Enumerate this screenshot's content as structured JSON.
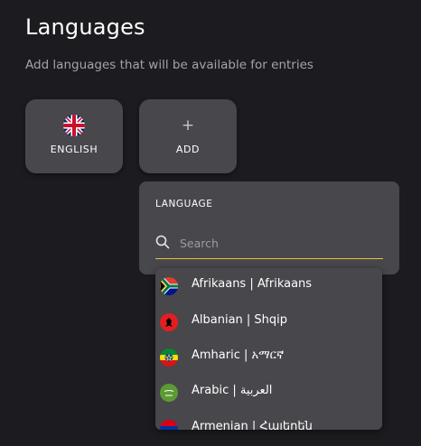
{
  "page": {
    "title": "Languages",
    "subtitle": "Add languages that will be available for entries"
  },
  "cards": {
    "english": {
      "label": "ENGLISH",
      "icon": "uk-flag-icon"
    },
    "add": {
      "label": "ADD",
      "icon_glyph": "+"
    }
  },
  "language_picker": {
    "label": "LANGUAGE",
    "search_placeholder": "Search",
    "underline_color": "#e6c436",
    "options": [
      {
        "label": "Afrikaans | Afrikaans",
        "icon": "south-africa-flag-icon"
      },
      {
        "label": "Albanian | Shqip",
        "icon": "albania-flag-icon"
      },
      {
        "label": "Amharic | አማርኛ",
        "icon": "ethiopia-flag-icon"
      },
      {
        "label": "Arabic | العربية",
        "icon": "saudi-arabia-flag-icon"
      },
      {
        "label": "Armenian | Հայերեն",
        "icon": "armenia-flag-icon"
      }
    ]
  },
  "colors": {
    "background": "#1c1c20",
    "card": "#48474c",
    "accent": "#e6c436"
  }
}
